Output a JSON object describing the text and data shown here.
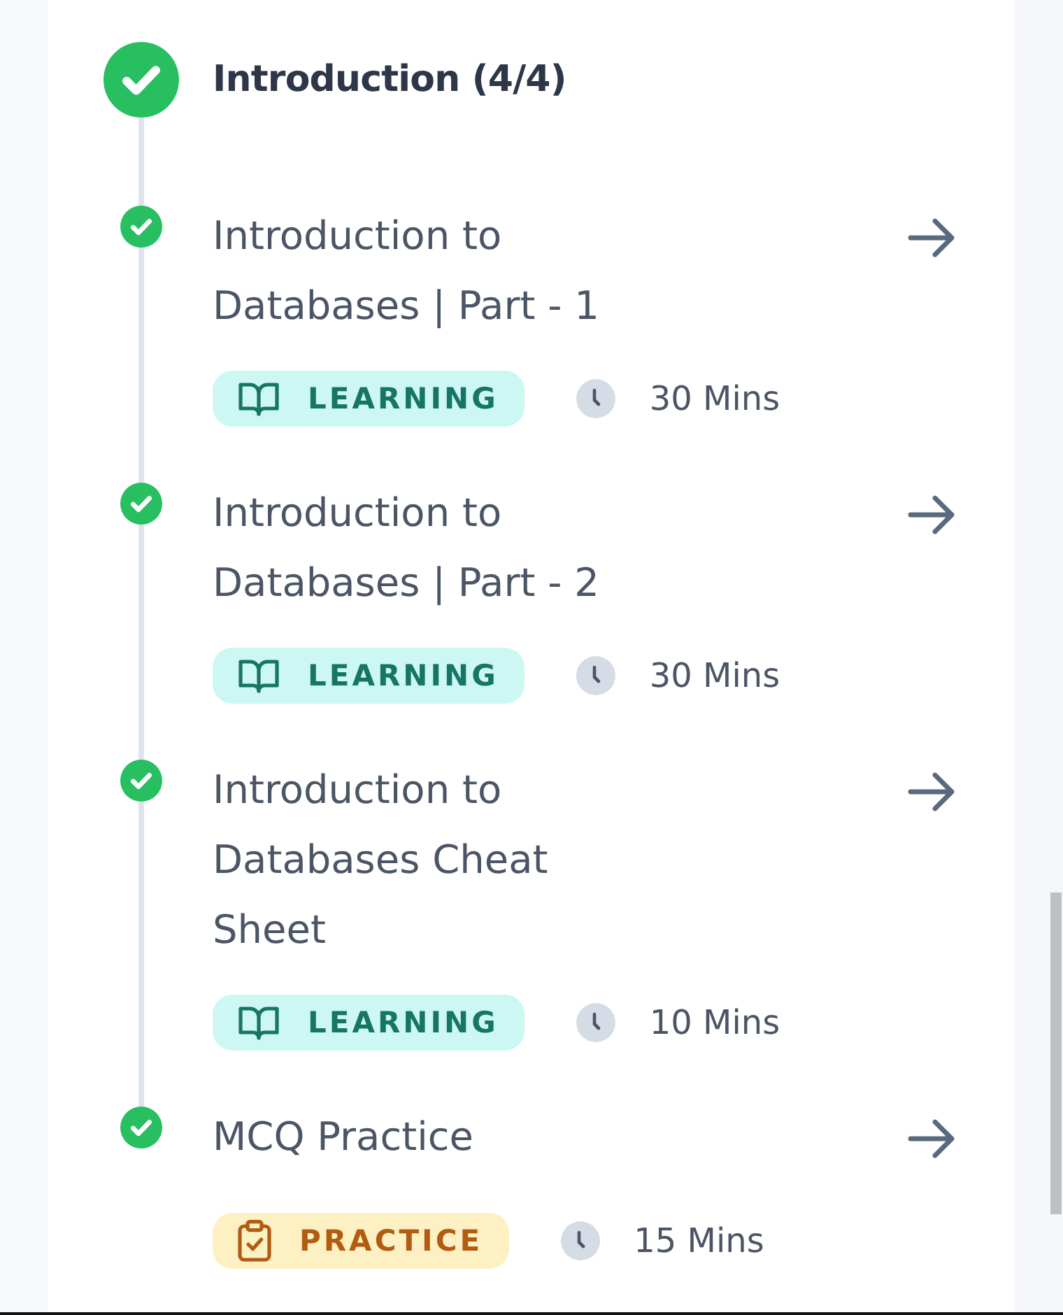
{
  "section": {
    "title": "Introduction (4/4)",
    "completed": true
  },
  "items": [
    {
      "title": "Introduction to Databases | Part - 1",
      "completed": true,
      "kind": "learning",
      "tag": "LEARNING",
      "duration": "30 Mins"
    },
    {
      "title": "Introduction to Databases | Part - 2",
      "completed": true,
      "kind": "learning",
      "tag": "LEARNING",
      "duration": "30 Mins"
    },
    {
      "title": "Introduction to Databases Cheat Sheet",
      "completed": true,
      "kind": "learning",
      "tag": "LEARNING",
      "duration": "10 Mins"
    },
    {
      "title": "MCQ Practice",
      "completed": true,
      "kind": "practice",
      "tag": "PRACTICE",
      "duration": "15 Mins"
    }
  ]
}
